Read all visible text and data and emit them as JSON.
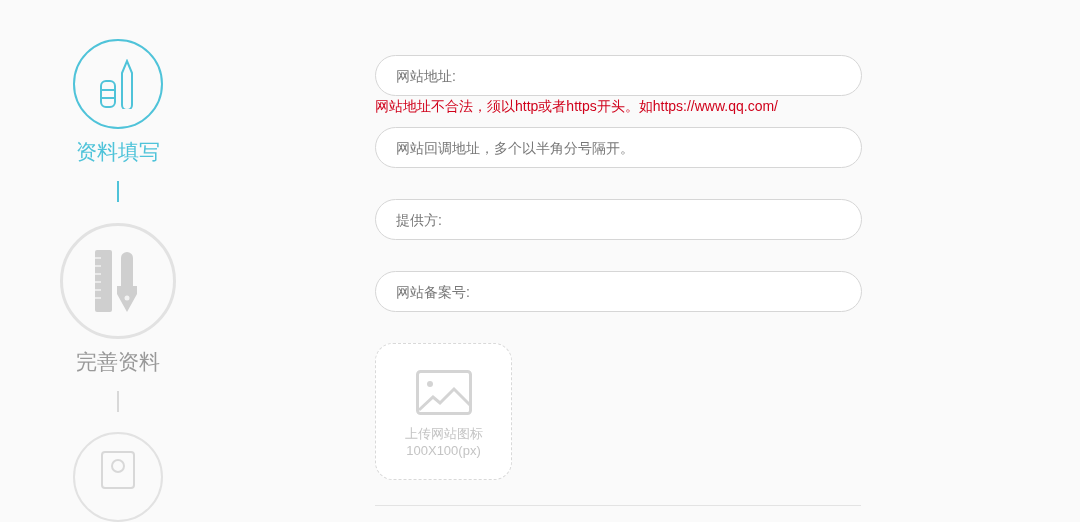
{
  "steps": [
    {
      "label": "资料填写",
      "selected": true
    },
    {
      "label": "完善资料",
      "selected": false
    },
    {
      "selected": false
    }
  ],
  "fields": [
    {
      "placeholder": "网站地址:",
      "error": "网站地址不合法，须以http或者https开头。如https://www.qq.com/"
    },
    {
      "placeholder": "网站回调地址，多个以半角分号隔开。"
    },
    {
      "placeholder": "提供方:"
    },
    {
      "placeholder": "网站备案号:"
    }
  ],
  "upload": {
    "label": "上传网站图标",
    "size_hint": "100X100(px)"
  }
}
